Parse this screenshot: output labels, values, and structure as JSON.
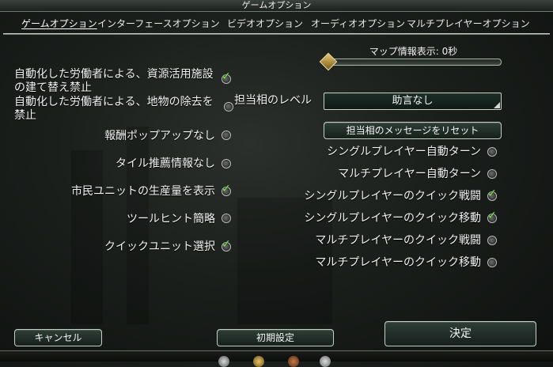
{
  "window": {
    "title": "ゲームオプション"
  },
  "tabs": [
    {
      "label": "ゲームオプション",
      "active": true
    },
    {
      "label": "インターフェースオプション",
      "active": false
    },
    {
      "label": "ビデオオプション",
      "active": false
    },
    {
      "label": "オーディオオプション",
      "active": false
    },
    {
      "label": "マルチプレイヤーオプション",
      "active": false
    }
  ],
  "left_options": [
    {
      "label": "自動化した労働者による、資源活用施設の建て替え禁止",
      "checked": true
    },
    {
      "label": "自動化した労働者による、地物の除去を禁止",
      "checked": false
    },
    {
      "label": "報酬ポップアップなし",
      "checked": false
    },
    {
      "label": "タイル推薦情報なし",
      "checked": false
    },
    {
      "label": "市民ユニットの生産量を表示",
      "checked": true
    },
    {
      "label": "ツールヒント簡略",
      "checked": false
    },
    {
      "label": "クイックユニット選択",
      "checked": true
    }
  ],
  "map_info": {
    "label": "マップ情報表示: 0秒",
    "value_seconds": 0
  },
  "advisor": {
    "label": "担当相のレベル",
    "selected": "助言なし"
  },
  "reset_button": {
    "label": "担当相のメッセージをリセット"
  },
  "right_options": [
    {
      "label": "シングルプレイヤー自動ターン",
      "checked": false
    },
    {
      "label": "マルチプレイヤー自動ターン",
      "checked": false
    },
    {
      "label": "シングルプレイヤーのクイック戦闘",
      "checked": true
    },
    {
      "label": "シングルプレイヤーのクイック移動",
      "checked": true
    },
    {
      "label": "マルチプレイヤーのクイック戦闘",
      "checked": false
    },
    {
      "label": "マルチプレイヤーのクイック移動",
      "checked": false
    }
  ],
  "footer": {
    "cancel_label": "キャンセル",
    "defaults_label": "初期設定",
    "ok_label": "決定"
  },
  "colors": {
    "check": "#7ee05a",
    "accent": "#e5c875",
    "frame": "#c6cfc6"
  }
}
